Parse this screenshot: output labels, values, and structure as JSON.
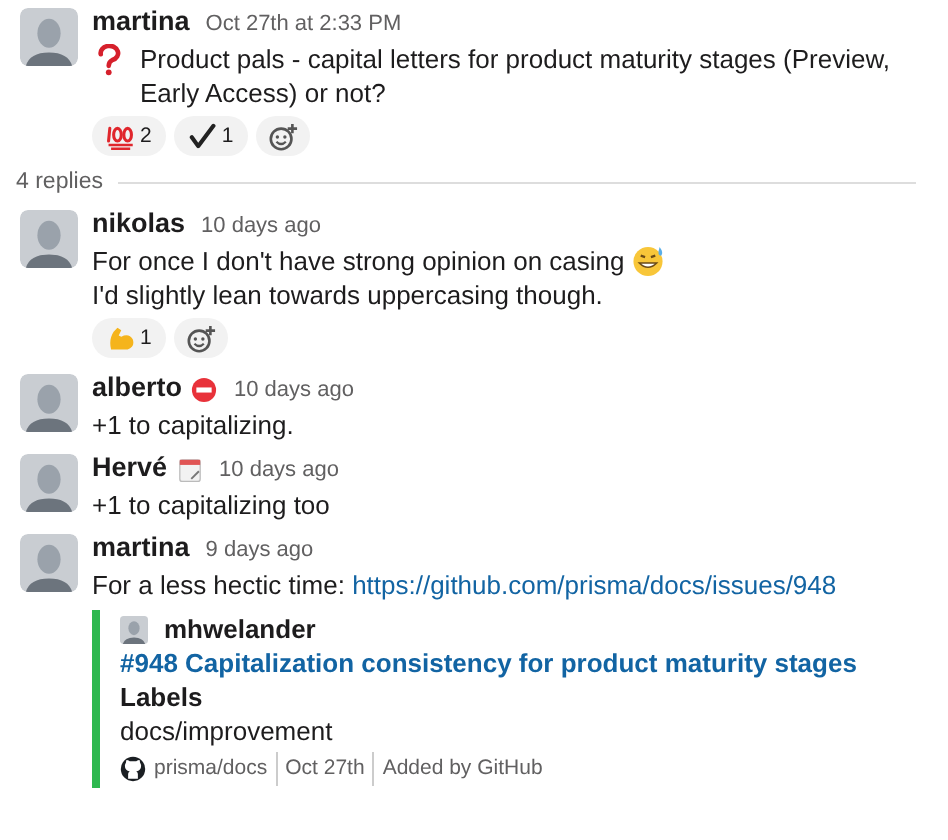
{
  "messages": [
    {
      "author": "martina",
      "time": "Oct 27th at 2:33 PM",
      "parts": [
        {
          "kind": "question"
        },
        {
          "kind": "text",
          "text": "Product pals - capital letters for product maturity stages (Preview, Early Access) or not?"
        }
      ],
      "reactions": [
        {
          "kind": "hundred",
          "count": "2"
        },
        {
          "kind": "check",
          "count": "1"
        }
      ],
      "add_reaction": true
    },
    {
      "kind": "divider",
      "label": "4 replies"
    },
    {
      "author": "nikolas",
      "time": "10 days ago",
      "parts": [
        {
          "kind": "text",
          "text": "For once I don't have strong opinion on casing"
        },
        {
          "kind": "sweatsmile"
        },
        {
          "kind": "text",
          "text": "I'd slightly lean towards uppercasing though."
        }
      ],
      "reactions": [
        {
          "kind": "muscle",
          "count": "1"
        }
      ],
      "add_reaction": true
    },
    {
      "author": "alberto",
      "status": {
        "kind": "noentry"
      },
      "time": "10 days ago",
      "parts": [
        {
          "kind": "text",
          "text": "+1 to capitalizing."
        }
      ]
    },
    {
      "author": "Hervé",
      "status": {
        "kind": "calendar"
      },
      "time": "10 days ago",
      "parts": [
        {
          "kind": "text",
          "text": "+1 to capitalizing too"
        }
      ]
    },
    {
      "author": "martina",
      "time": "9 days ago",
      "parts": [
        {
          "kind": "text",
          "text": "For a less hectic time:"
        },
        {
          "kind": "link",
          "text": "https://github.com/prisma/docs/issues/948"
        }
      ],
      "attachment": {
        "author": "mhwelander",
        "title": "#948 Capitalization consistency for product maturity stages",
        "field_label": "Labels",
        "field_value": "docs/improvement",
        "footer": [
          "prisma/docs",
          "Oct 27th",
          "Added by GitHub"
        ]
      }
    }
  ]
}
